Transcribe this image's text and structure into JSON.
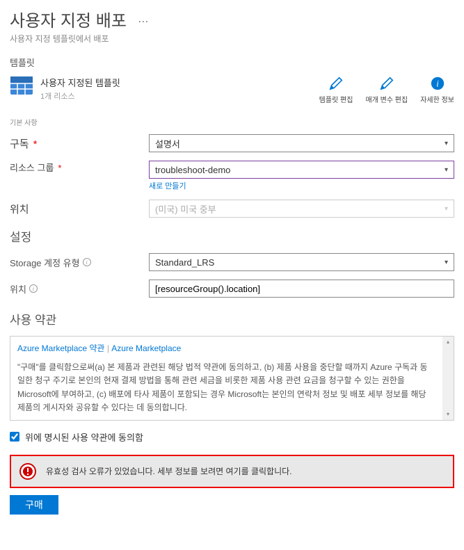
{
  "header": {
    "title": "사용자 지정 배포",
    "subtitle": "사용자 지정 템플릿에서 배포"
  },
  "template": {
    "heading": "템플릿",
    "name": "사용자 지정된 템플릿",
    "resources": "1개 리소스",
    "actions": {
      "edit_template": "템플릿 편집",
      "edit_params": "매개 변수 편집",
      "more_info": "자세한 정보"
    }
  },
  "basics": {
    "heading": "기본 사항",
    "subscription_label": "구독",
    "subscription_value": "설명서",
    "resource_group_label": "리소스 그룹",
    "resource_group_value": "troubleshoot-demo",
    "create_new": "새로 만들기",
    "location_label": "위치",
    "location_value": "(미국) 미국 중부"
  },
  "settings": {
    "heading": "설정",
    "storage_type_label": "Storage 계정 유형",
    "storage_type_value": "Standard_LRS",
    "location_label": "위치",
    "location_value": "[resourceGroup().location]"
  },
  "terms": {
    "heading": "사용 약관",
    "link1": "Azure Marketplace 약관",
    "link2": "Azure Marketplace",
    "body": "\"구매\"를 클릭함으로써(a) 본 제품과 관련된 해당 법적 약관에 동의하고, (b) 제품 사용을 중단할 때까지 Azure 구독과 동일한 청구 주기로 본인의 현재 결제 방법을 통해 관련 세금을 비롯한 제품 사용 관련 요금을 청구할 수 있는 권한을 Microsoft에 부여하고, (c) 배포에 타사 제품이 포함되는 경우 Microsoft는 본인의 연락처 정보 및 배포 세부 정보를 해당 제품의 게시자와 공유할 수 있다는 데 동의합니다.",
    "agree_label": "위에 명시된 사용 약관에 동의함"
  },
  "error": {
    "message": "유효성 검사 오류가 있었습니다. 세부 정보를 보려면 여기를 클릭합니다."
  },
  "actions": {
    "buy": "구매"
  }
}
